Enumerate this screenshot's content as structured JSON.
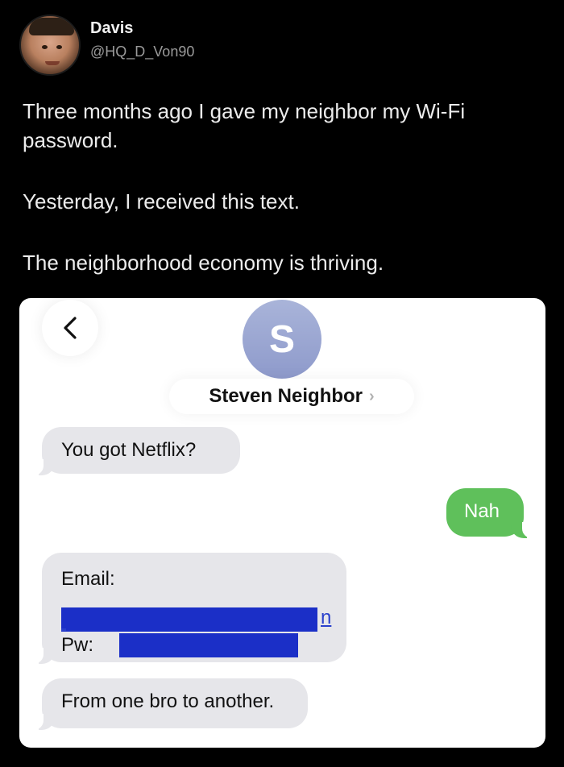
{
  "tweet": {
    "display_name": "Davis",
    "handle": "@HQ_D_Von90",
    "paragraphs": [
      "Three months ago I gave my neighbor my Wi-Fi password.",
      "Yesterday, I received this text.",
      "The neighborhood economy is thriving."
    ]
  },
  "conversation": {
    "back_icon": "chevron-left-icon",
    "contact_initial": "S",
    "contact_name": "Steven Neighbor",
    "contact_chevron": "›",
    "messages": [
      {
        "direction": "incoming",
        "text": "You got Netflix?"
      },
      {
        "direction": "outgoing",
        "text": "Nah"
      },
      {
        "direction": "incoming",
        "email_label": "Email:",
        "email_tail": "n",
        "pw_label": "Pw:"
      },
      {
        "direction": "incoming",
        "text": "From one bro to another."
      }
    ],
    "colors": {
      "incoming_bubble": "#e6e6ea",
      "outgoing_bubble": "#5fc05b",
      "redaction": "#1b2fc7",
      "contact_avatar": "#8e9acb"
    }
  }
}
